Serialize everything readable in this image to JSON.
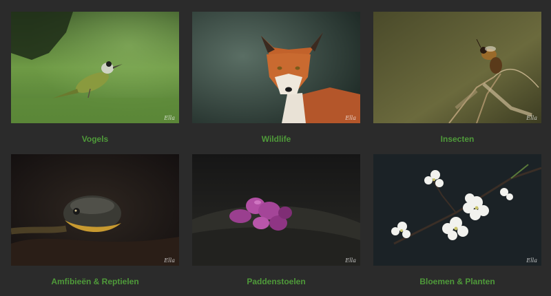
{
  "gallery": {
    "items": [
      {
        "label": "Vogels",
        "image": "green-woodpecker-photo"
      },
      {
        "label": "Wildlife",
        "image": "red-fox-photo"
      },
      {
        "label": "Insecten",
        "image": "bee-on-grass-photo"
      },
      {
        "label": "Amfibieën & Reptielen",
        "image": "snake-head-photo"
      },
      {
        "label": "Paddenstoelen",
        "image": "purple-jelly-fungus-photo"
      },
      {
        "label": "Bloemen & Planten",
        "image": "white-blossom-photo"
      }
    ],
    "watermark": "Ella",
    "colors": {
      "background": "#2b2b2b",
      "label": "#4f9a3a"
    }
  }
}
